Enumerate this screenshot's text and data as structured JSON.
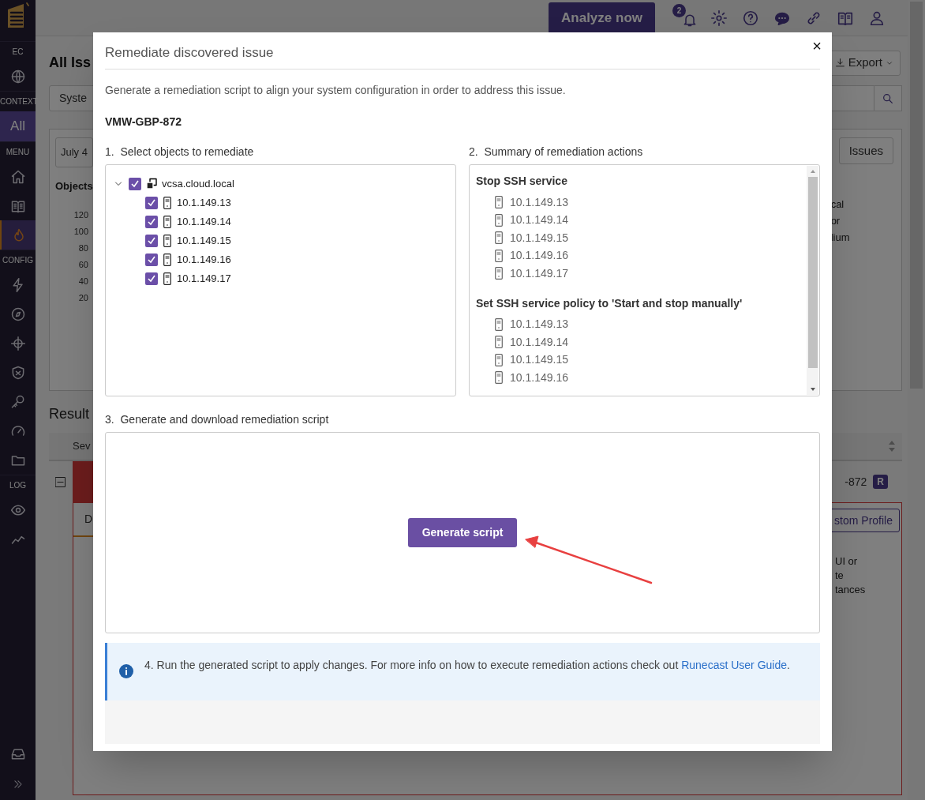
{
  "sidebar": {
    "items": [
      {
        "kind": "logo"
      },
      {
        "kind": "label",
        "text": "EC"
      },
      {
        "kind": "icon",
        "selected": false
      },
      {
        "kind": "label",
        "text": "CONTEXT"
      },
      {
        "kind": "context",
        "text": "All"
      },
      {
        "kind": "label",
        "text": "MENU"
      },
      {
        "kind": "icon",
        "selected": false
      },
      {
        "kind": "icon",
        "selected": false
      },
      {
        "kind": "icon",
        "selected": true
      },
      {
        "kind": "label",
        "text": "CONFIG"
      },
      {
        "kind": "icon",
        "selected": false
      },
      {
        "kind": "icon",
        "selected": false
      },
      {
        "kind": "icon",
        "selected": false
      },
      {
        "kind": "icon",
        "selected": false
      },
      {
        "kind": "icon",
        "selected": false
      },
      {
        "kind": "icon",
        "selected": false
      },
      {
        "kind": "icon",
        "selected": false
      },
      {
        "kind": "label",
        "text": "LOG"
      },
      {
        "kind": "icon",
        "selected": false
      },
      {
        "kind": "icon",
        "selected": false
      }
    ]
  },
  "top_bar": {
    "analyze_button": "Analyze now",
    "notification_count": "2"
  },
  "background": {
    "page_title": "All Iss",
    "filter_value": "Syste",
    "export_button": "Export",
    "date_button": "July 4",
    "view_button": "Issues",
    "chart_title": "Objects",
    "axis_labels": [
      "120",
      "100",
      "80",
      "60",
      "40",
      "20"
    ],
    "legend_fragments": [
      "cal",
      "or",
      "lium"
    ],
    "results_title": "Result",
    "column_header": "Sev",
    "issue_id_fragment": "-872",
    "issue_badge": "R",
    "tab_fragment": "D",
    "profile_button": "stom Profile",
    "text_fragments": [
      "UI or",
      "te",
      "tances"
    ]
  },
  "modal": {
    "title": "Remediate discovered issue",
    "close": "×",
    "description": "Generate a remediation script to align your system configuration in order to address this issue.",
    "issue_id": "VMW-GBP-872",
    "step1": {
      "label": "1.  Select objects to remediate",
      "tree": {
        "label": "vcsa.cloud.local",
        "expanded": true,
        "checked": true,
        "children": [
          {
            "label": "10.1.149.13",
            "checked": true
          },
          {
            "label": "10.1.149.14",
            "checked": true
          },
          {
            "label": "10.1.149.15",
            "checked": true
          },
          {
            "label": "10.1.149.16",
            "checked": true
          },
          {
            "label": "10.1.149.17",
            "checked": true
          }
        ]
      }
    },
    "step2": {
      "label": "2.  Summary of remediation actions",
      "groups": [
        {
          "title": "Stop SSH service",
          "items": [
            "10.1.149.13",
            "10.1.149.14",
            "10.1.149.15",
            "10.1.149.16",
            "10.1.149.17"
          ]
        },
        {
          "title": "Set SSH service policy to 'Start and stop manually'",
          "items": [
            "10.1.149.13",
            "10.1.149.14",
            "10.1.149.15",
            "10.1.149.16"
          ]
        }
      ]
    },
    "step3": {
      "label": "3.  Generate and download remediation script",
      "button": "Generate script"
    },
    "step4": {
      "text": "4. Run the generated script to apply changes. For more info on how to execute remediation actions check out ",
      "link": "Runecast User Guide",
      "after": "."
    }
  }
}
